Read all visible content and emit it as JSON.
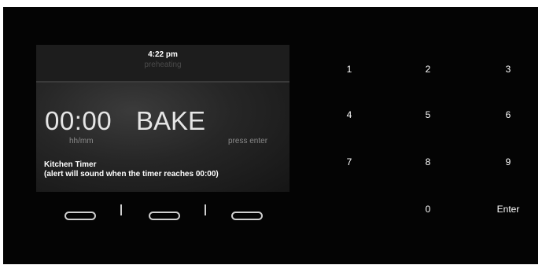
{
  "display": {
    "time": "4:22 pm",
    "status": "preheating",
    "timer_value": "00:00",
    "mode": "BAKE",
    "unit": "hh/mm",
    "hint": "press enter",
    "title": "Kitchen Timer",
    "description": "(alert will sound when the timer reaches 00:00)"
  },
  "keypad": {
    "k1": "1",
    "k2": "2",
    "k3": "3",
    "k4": "4",
    "k5": "5",
    "k6": "6",
    "k7": "7",
    "k8": "8",
    "k9": "9",
    "k0": "0",
    "enter": "Enter"
  },
  "colors": {
    "background": "#040404",
    "screen": "#262626",
    "text": "#ffffff"
  }
}
